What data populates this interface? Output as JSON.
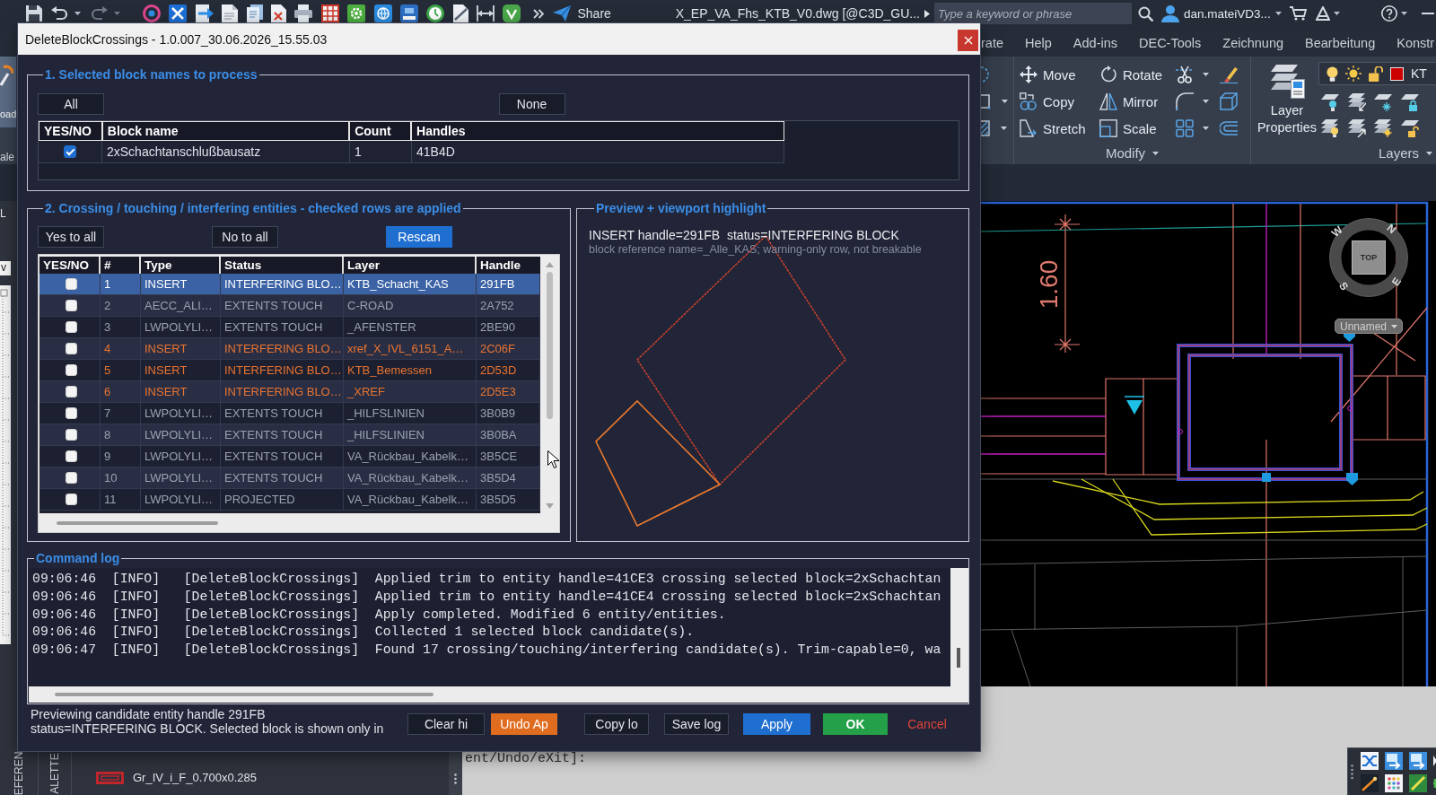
{
  "title_bar": {
    "share_label": "Share",
    "document_title": "X_EP_VA_Fhs_KTB_V0.dwg [@C3D_GU...",
    "search": {
      "placeholder": "Type a keyword or phrase"
    },
    "user_name": "dan.mateiVD3..."
  },
  "ribbon_tabs": [
    {
      "label": "rate",
      "selected": false
    },
    {
      "label": "Help",
      "selected": false
    },
    {
      "label": "Add-ins",
      "selected": false
    },
    {
      "label": "DEC-Tools",
      "selected": false
    },
    {
      "label": "Zeichnung",
      "selected": false
    },
    {
      "label": "Bearbeitung",
      "selected": false
    },
    {
      "label": "Konstr",
      "selected": false
    }
  ],
  "left_edge": {
    "ribbon_button": "oad",
    "ribbon_label": "ale",
    "label": "L",
    "field_value": "v"
  },
  "ribbon": {
    "modify": {
      "tools": [
        "Move",
        "Rotate",
        "Copy",
        "Mirror",
        "Stretch",
        "Scale"
      ],
      "title": "Modify"
    },
    "layers": {
      "properties_label": "Layer Properties",
      "current_layer": "KT",
      "title": "Layers"
    }
  },
  "drawing": {
    "dimension_text": "1.60",
    "viewcube_face": "TOP",
    "compass": [
      "N",
      "E",
      "S",
      "W"
    ],
    "view_name": "Unnamed"
  },
  "palette": {
    "tabs": [
      "EFEREN",
      "ALETTE"
    ],
    "item_label": "Gr_IV_i_F_0.700x0.285"
  },
  "command_line": "ent/Undo/eXit]:",
  "dialog": {
    "title": "DeleteBlockCrossings - 1.0.007_30.06.2026_15.55.03",
    "block_group": {
      "legend": "1. Selected block names to process",
      "buttons": [
        "All",
        "None"
      ],
      "columns": [
        "YES/NO",
        "Block name",
        "Count",
        "Handles"
      ],
      "rows": [
        {
          "checked": true,
          "block_name": "2xSchachtanschlußbausatz",
          "count": "1",
          "handles": "41B4D"
        }
      ]
    },
    "entity_group": {
      "legend": "2. Crossing / touching / interfering entities - checked rows are applied",
      "buttons": [
        {
          "label": "Yes to all",
          "kind": "default"
        },
        {
          "label": "No to all",
          "kind": "default"
        },
        {
          "label": "Rescan",
          "kind": "primary"
        }
      ],
      "columns": [
        "YES/NO",
        "#",
        "Type",
        "Status",
        "Layer",
        "Handle"
      ],
      "rows": [
        {
          "checked": false,
          "selected": true,
          "warning": false,
          "number": "1",
          "type": "INSERT",
          "status": "INTERFERING BLO…",
          "layer": "KTB_Schacht_KAS",
          "handle": "291FB"
        },
        {
          "checked": false,
          "selected": false,
          "warning": false,
          "number": "2",
          "type": "AECC_ALI…",
          "status": "EXTENTS TOUCH",
          "layer": "C-ROAD",
          "handle": "2A752"
        },
        {
          "checked": false,
          "selected": false,
          "warning": false,
          "number": "3",
          "type": "LWPOLYLI…",
          "status": "EXTENTS TOUCH",
          "layer": "_AFENSTER",
          "handle": "2BE90"
        },
        {
          "checked": false,
          "selected": false,
          "warning": true,
          "number": "4",
          "type": "INSERT",
          "status": "INTERFERING BLO…",
          "layer": "xref_X_IVL_6151_A…",
          "handle": "2C06F"
        },
        {
          "checked": false,
          "selected": false,
          "warning": true,
          "number": "5",
          "type": "INSERT",
          "status": "INTERFERING BLO…",
          "layer": "KTB_Bemessen",
          "handle": "2D53D"
        },
        {
          "checked": false,
          "selected": false,
          "warning": true,
          "number": "6",
          "type": "INSERT",
          "status": "INTERFERING BLO…",
          "layer": "_XREF",
          "handle": "2D5E3"
        },
        {
          "checked": false,
          "selected": false,
          "warning": false,
          "number": "7",
          "type": "LWPOLYLI…",
          "status": "EXTENTS TOUCH",
          "layer": "_HILFSLINIEN",
          "handle": "3B0B9"
        },
        {
          "checked": false,
          "selected": false,
          "warning": false,
          "number": "8",
          "type": "LWPOLYLI…",
          "status": "EXTENTS TOUCH",
          "layer": "_HILFSLINIEN",
          "handle": "3B0BA"
        },
        {
          "checked": false,
          "selected": false,
          "warning": false,
          "number": "9",
          "type": "LWPOLYLI…",
          "status": "EXTENTS TOUCH",
          "layer": "VA_Rückbau_Kabelk…",
          "handle": "3B5CE"
        },
        {
          "checked": false,
          "selected": false,
          "warning": false,
          "number": "10",
          "type": "LWPOLYLI…",
          "status": "EXTENTS TOUCH",
          "layer": "VA_Rückbau_Kabelk…",
          "handle": "3B5D4"
        },
        {
          "checked": false,
          "selected": false,
          "warning": false,
          "number": "11",
          "type": "LWPOLYLI…",
          "status": "PROJECTED",
          "layer": "VA_Rückbau_Kabelk…",
          "handle": "3B5D5"
        }
      ]
    },
    "preview": {
      "legend": "Preview + viewport highlight",
      "headline": "INSERT handle=291FB  status=INTERFERING BLOCK",
      "detail": "block reference name=_Alle_KAS; warning-only row, not breakable"
    },
    "log": {
      "legend": "Command log",
      "lines": [
        "09:06:46  [INFO]   [DeleteBlockCrossings]  Applied trim to entity handle=41CE3 crossing selected block=2xSchachtan",
        "09:06:46  [INFO]   [DeleteBlockCrossings]  Applied trim to entity handle=41CE4 crossing selected block=2xSchachtan",
        "09:06:46  [INFO]   [DeleteBlockCrossings]  Apply completed. Modified 6 entity/entities.",
        "09:06:46  [INFO]   [DeleteBlockCrossings]  Collected 1 selected block candidate(s).",
        "09:06:47  [INFO]   [DeleteBlockCrossings]  Found 17 crossing/touching/interfering candidate(s). Trim-capable=0, wa"
      ]
    },
    "status_text": [
      "Previewing candidate entity handle 291FB",
      "status=INTERFERING BLOCK. Selected block is shown only in"
    ],
    "buttons": [
      {
        "label": "Clear hi",
        "kind": "default"
      },
      {
        "label": "Undo Ap",
        "kind": "warning"
      },
      {
        "label": "Copy lo",
        "kind": "default"
      },
      {
        "label": "Save log",
        "kind": "default"
      },
      {
        "label": "Apply",
        "kind": "primary"
      },
      {
        "label": "OK",
        "kind": "success"
      },
      {
        "label": "Cancel",
        "kind": "danger"
      }
    ]
  }
}
